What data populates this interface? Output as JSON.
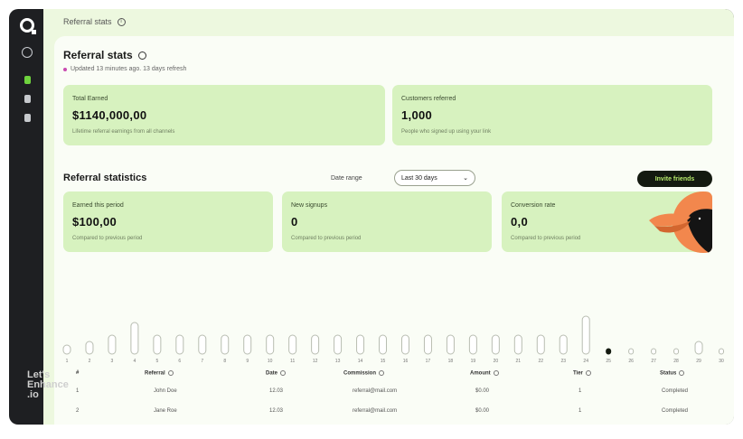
{
  "breadcrumb": {
    "text": "Referral stats"
  },
  "title": "Referral stats",
  "subtitle": "Updated 13 minutes ago. 13 days refresh",
  "stats_top": [
    {
      "label": "Total Earned",
      "value": "$1140,000,00",
      "note": "Lifetime referral earnings from all channels"
    },
    {
      "label": "Customers referred",
      "value": "1,000",
      "note": "People who signed up using your link"
    }
  ],
  "section": {
    "heading": "Referral statistics",
    "range_label": "Date range",
    "range_value": "Last 30 days",
    "cta": "Invite friends"
  },
  "stats_bottom": [
    {
      "label": "Earned this period",
      "value": "$100,00",
      "note": "Compared to previous period"
    },
    {
      "label": "New signups",
      "value": "0",
      "note": "Compared to previous period"
    },
    {
      "label": "Conversion rate",
      "value": "0,0",
      "note": "Compared to previous period"
    }
  ],
  "chart_data": {
    "type": "bar",
    "categories": [
      "1",
      "2",
      "3",
      "4",
      "5",
      "6",
      "7",
      "8",
      "9",
      "10",
      "11",
      "12",
      "13",
      "14",
      "15",
      "16",
      "17",
      "18",
      "19",
      "20",
      "21",
      "22",
      "23",
      "24",
      "25",
      "26",
      "27",
      "28",
      "29",
      "30"
    ],
    "values": [
      1,
      2,
      3,
      5,
      3,
      3,
      3,
      3,
      3,
      3,
      3,
      3,
      3,
      3,
      3,
      3,
      3,
      3,
      3,
      3,
      3,
      3,
      3,
      6,
      0,
      0,
      0,
      0,
      2,
      0
    ],
    "active_index": 24,
    "colors": {
      "bar": "#ffffff",
      "active": "#141a10",
      "outline": "#b8bdb1"
    }
  },
  "table": {
    "columns": [
      "#",
      "Referral",
      "Date",
      "Commission",
      "Amount",
      "Tier",
      "Status"
    ],
    "rows": [
      [
        "1",
        "John Doe",
        "12.03",
        "referral@mail.com",
        "$0.00",
        "1",
        "Completed"
      ],
      [
        "2",
        "Jane Roe",
        "12.03",
        "referral@mail.com",
        "$0.00",
        "1",
        "Completed"
      ]
    ]
  },
  "watermark": {
    "line1": "Let's",
    "line2": "Enhance",
    "line3": ".io"
  },
  "colors": {
    "accent": "#6fd33e",
    "card": "#d7f2bf",
    "dark": "#141a10",
    "panel": "#fafdf6",
    "toucan_beak": "#f2874d"
  }
}
